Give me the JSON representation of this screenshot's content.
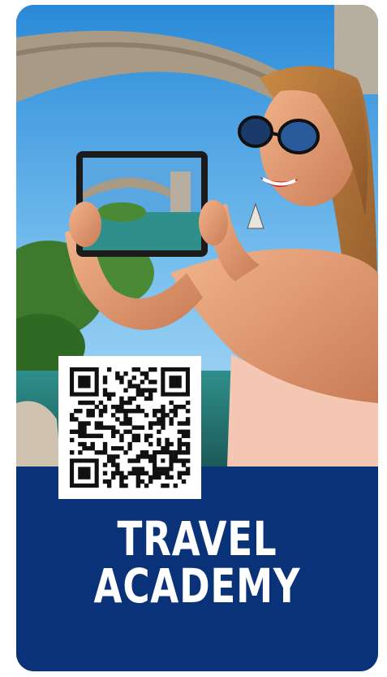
{
  "card": {
    "title_line1": "TRAVEL",
    "title_line2": "ACADEMY",
    "brand_color": "#0a3278",
    "text_color": "#ffffff"
  },
  "photo": {
    "subject": "woman-holding-tablet-near-stone-bridge-icon"
  },
  "qr_code": {
    "icon": "qr-code-icon"
  }
}
